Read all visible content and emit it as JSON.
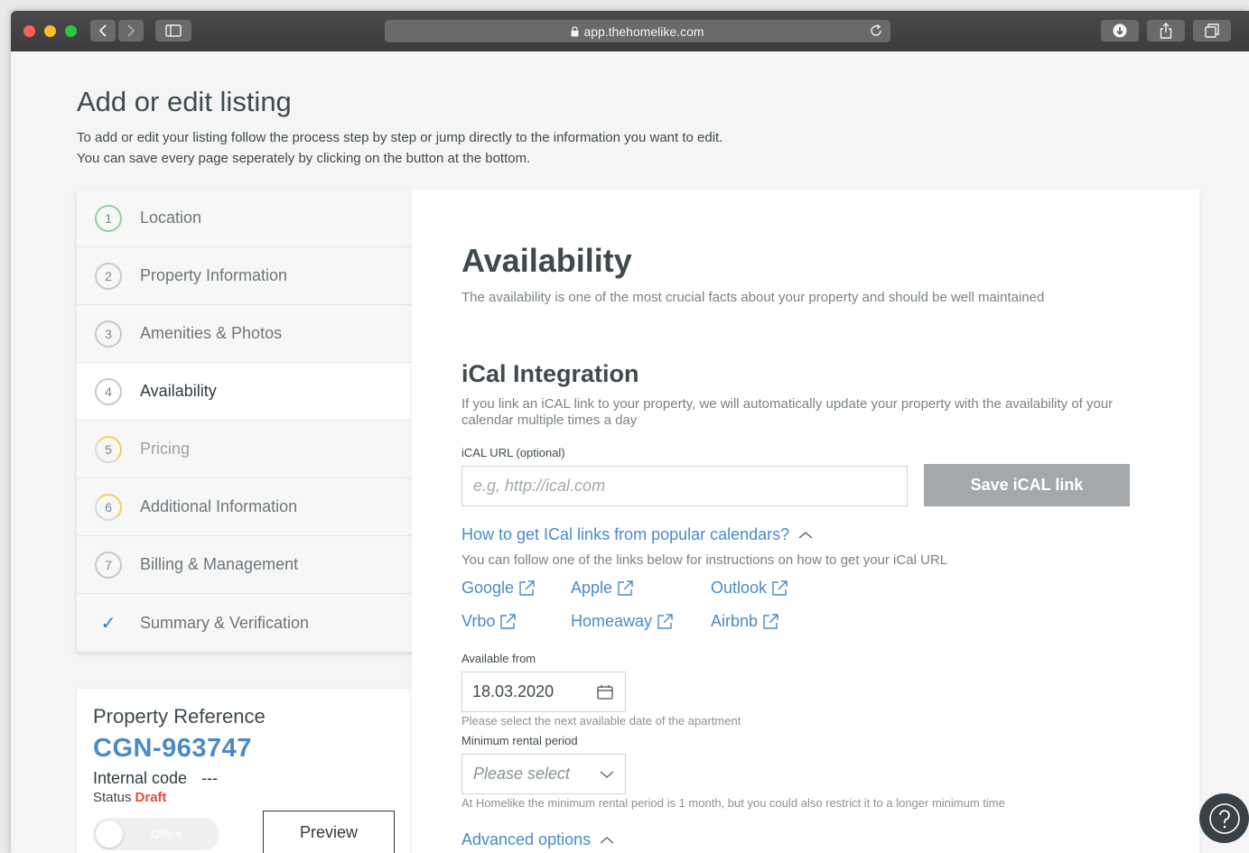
{
  "browser": {
    "url": "app.thehomelike.com"
  },
  "page": {
    "title": "Add or edit listing",
    "description": "To add or edit your listing follow the process step by step or jump directly to the information you want to edit. You can save every page seperately by clicking on the button at the bottom."
  },
  "steps": [
    {
      "num": "1",
      "label": "Location",
      "state": "complete"
    },
    {
      "num": "2",
      "label": "Property Information",
      "state": "todo"
    },
    {
      "num": "3",
      "label": "Amenities & Photos",
      "state": "todo"
    },
    {
      "num": "4",
      "label": "Availability",
      "state": "active"
    },
    {
      "num": "5",
      "label": "Pricing",
      "state": "partial"
    },
    {
      "num": "6",
      "label": "Additional Information",
      "state": "partial"
    },
    {
      "num": "7",
      "label": "Billing & Management",
      "state": "todo"
    },
    {
      "num": "✓",
      "label": "Summary & Verification",
      "state": "check"
    }
  ],
  "reference": {
    "title": "Property Reference",
    "code": "CGN-963747",
    "internal_label": "Internal code",
    "internal_value": "---",
    "status_label": "Status",
    "status_value": "Draft",
    "toggle_label": "Offline",
    "preview_label": "Preview"
  },
  "main": {
    "title": "Availability",
    "description": "The availability is one of the most crucial facts about your property and should be well maintained",
    "ical": {
      "title": "iCal Integration",
      "description": "If you link an iCAL link to your property, we will automatically update your property with the availability of your calendar multiple times a day",
      "url_label": "iCAL URL (optional)",
      "url_placeholder": "e.g, http://ical.com",
      "save_label": "Save iCAL link",
      "howto_label": "How to get ICal links from popular calendars?",
      "howto_desc": "You can follow one of the links below for instructions on how to get your iCal URL",
      "links": [
        "Google",
        "Apple",
        "Outlook",
        "Vrbo",
        "Homeaway",
        "Airbnb"
      ]
    },
    "available_from": {
      "label": "Available from",
      "value": "18.03.2020",
      "hint": "Please select the next available date of the apartment"
    },
    "min_rental": {
      "label": "Minimum rental period",
      "placeholder": "Please select",
      "hint": "At Homelike the minimum rental period is 1 month, but you could also restrict it to a longer minimum time"
    },
    "advanced_label": "Advanced options"
  },
  "colors": {
    "accent": "#4a8ac9",
    "draft": "#e94b3c",
    "button_disabled": "#a4a8aa"
  }
}
